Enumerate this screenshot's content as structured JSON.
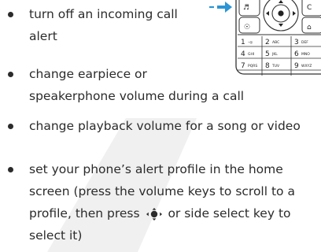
{
  "items": [
    {
      "lines": [
        "turn off an incoming call",
        "alert"
      ]
    },
    {
      "lines": [
        "change earpiece or",
        "speakerphone volume during a call"
      ]
    },
    {
      "lines": [
        "change playback volume for a song or video"
      ]
    },
    {
      "lines": [
        "set your phone’s alert profile in the home",
        "screen (press the volume keys to scroll to a"
      ],
      "line3_before_icon": "profile, then press",
      "line3_after_icon": "or side select key to",
      "line4": "select it)"
    }
  ],
  "keypad": {
    "keys": [
      {
        "num": "1",
        "sub": "–◎"
      },
      {
        "num": "2",
        "sub": "ABC"
      },
      {
        "num": "3",
        "sub": "DEF"
      },
      {
        "num": "4",
        "sub": "GHI"
      },
      {
        "num": "5",
        "sub": "JKL"
      },
      {
        "num": "6",
        "sub": "MNO"
      },
      {
        "num": "7",
        "sub": "PQRS"
      },
      {
        "num": "8",
        "sub": "TUV"
      },
      {
        "num": "9",
        "sub": "WXYZ"
      }
    ]
  },
  "colors": {
    "arrow": "#2b95d6",
    "text": "#2b2b2b",
    "watermark": "#f0f0f0"
  },
  "icons": [
    "nav-select-icon",
    "keypad-arrow-icon"
  ]
}
